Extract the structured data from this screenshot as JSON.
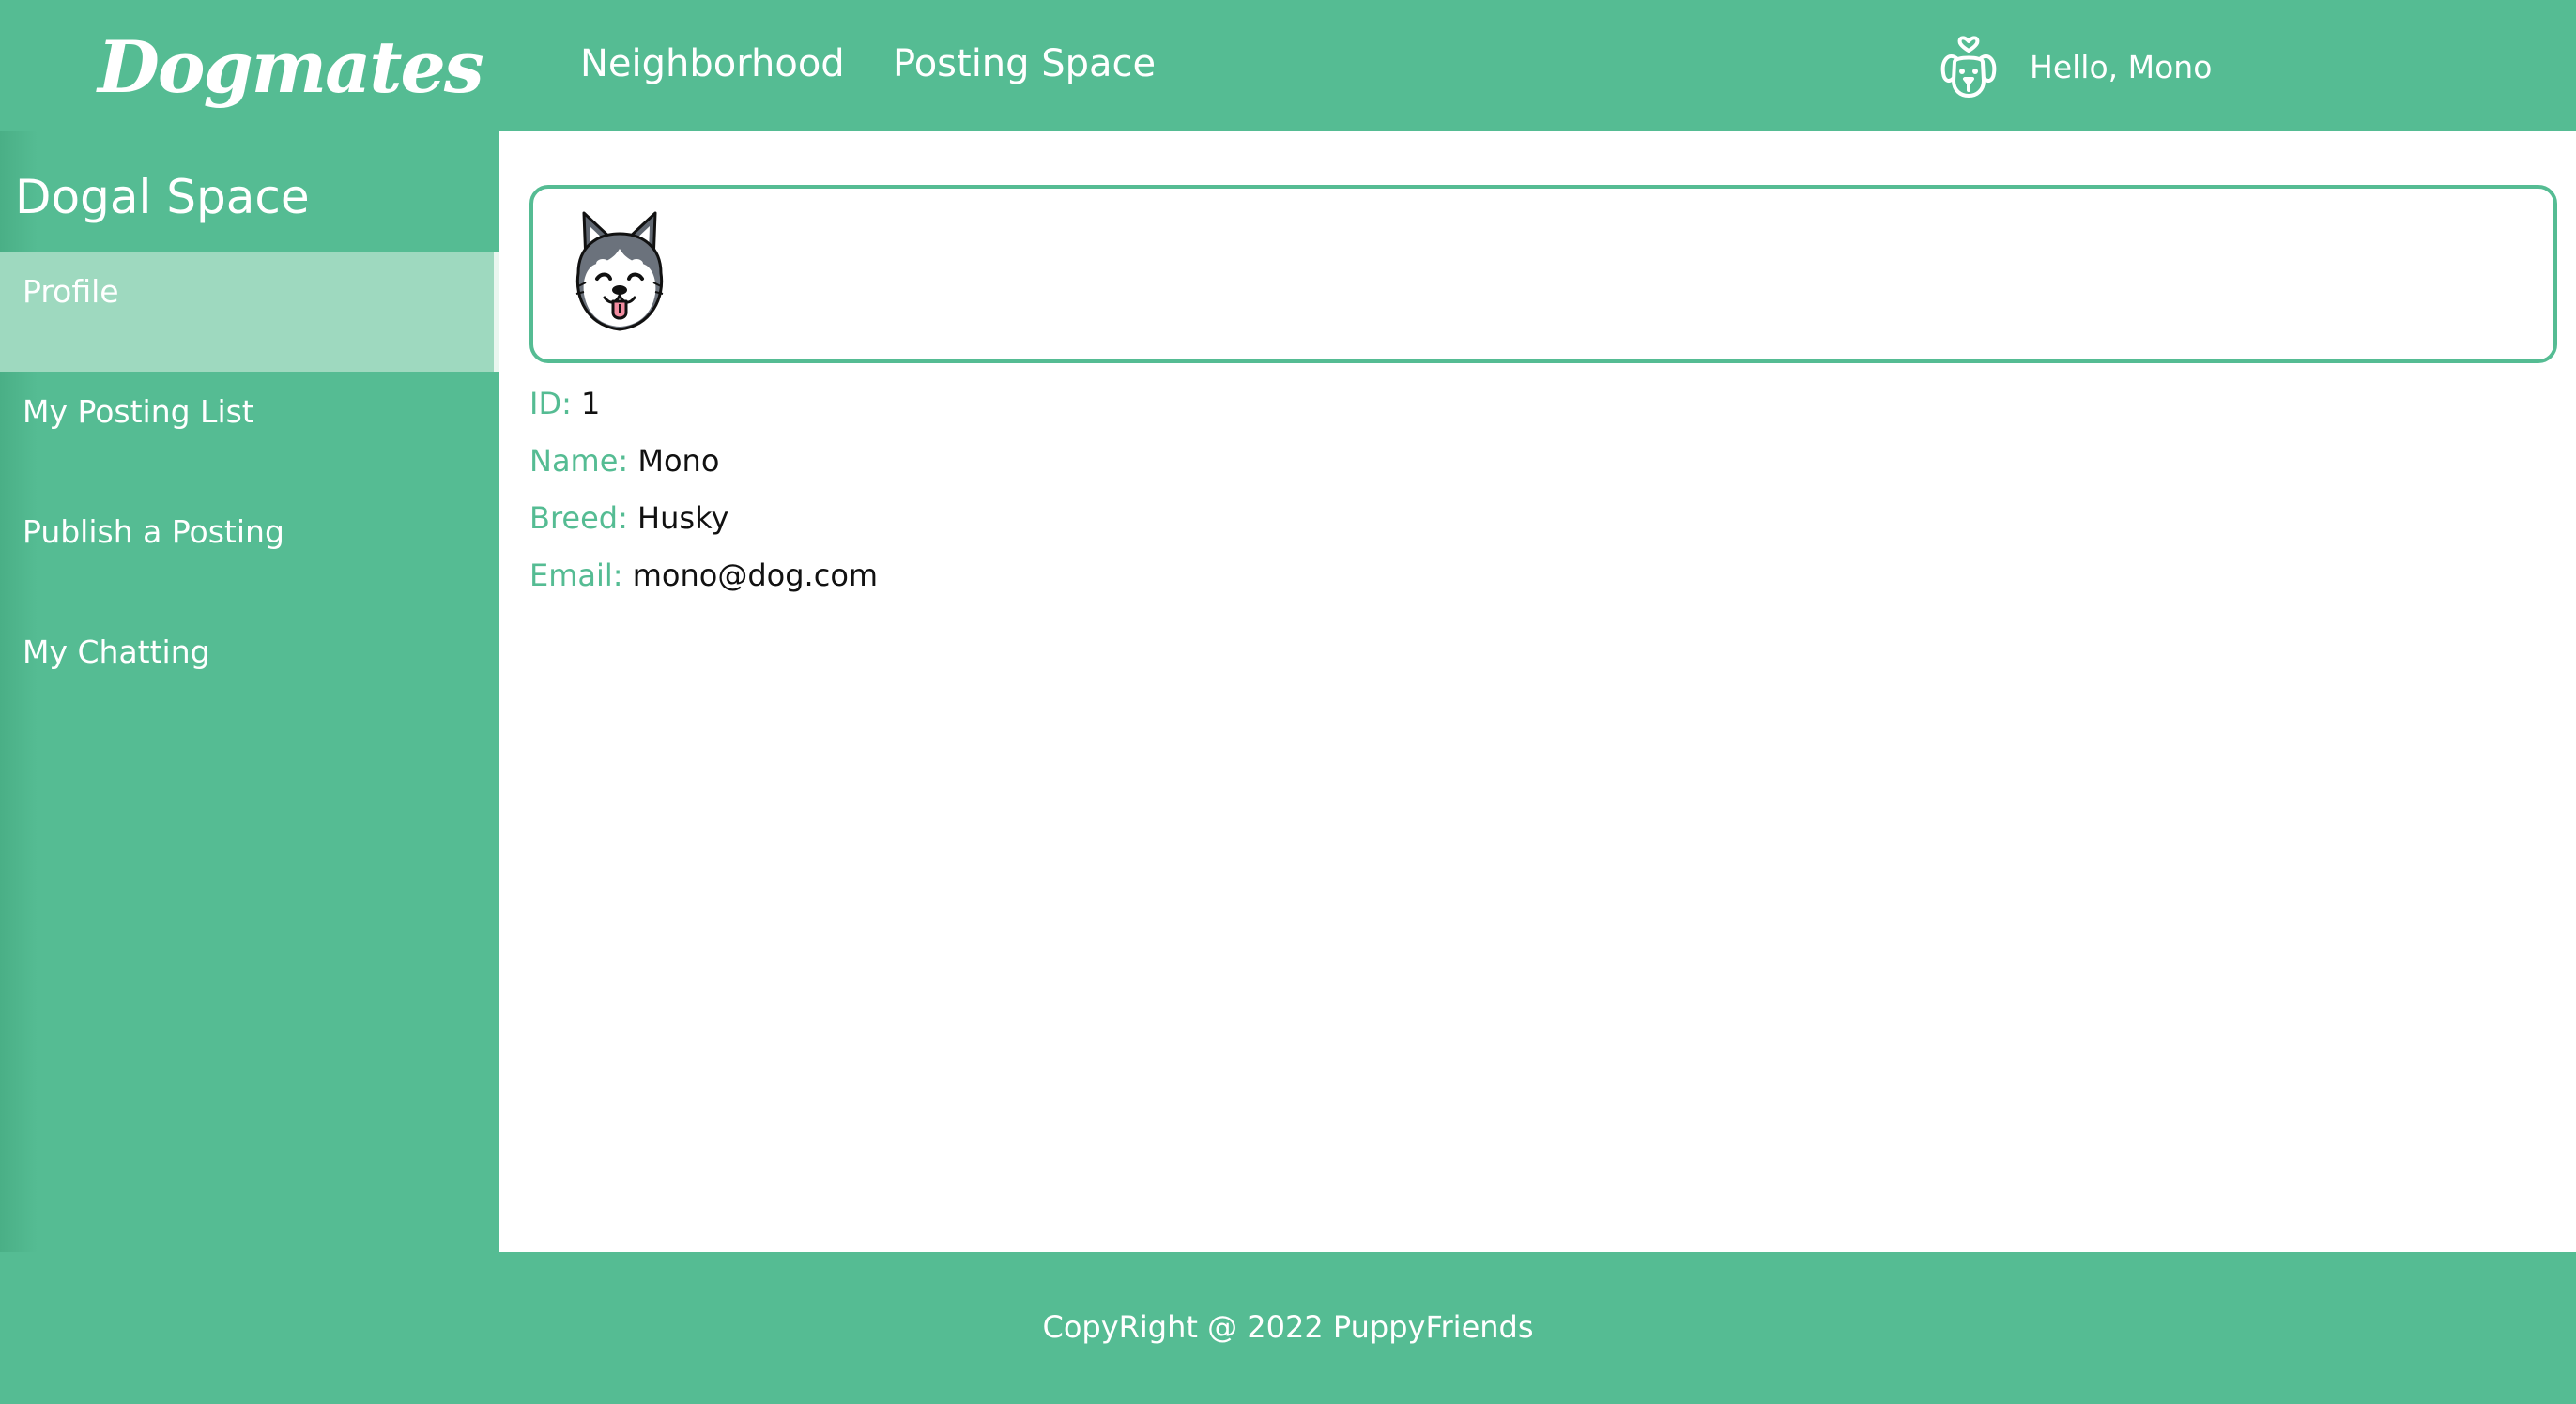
{
  "header": {
    "logo": "Dogmates",
    "nav": [
      {
        "label": "Neighborhood"
      },
      {
        "label": "Posting Space"
      }
    ],
    "user": {
      "icon": "dog-face-icon",
      "greeting": "Hello, Mono"
    }
  },
  "sidebar": {
    "title": "Dogal Space",
    "items": [
      {
        "label": "Profile",
        "active": true
      },
      {
        "label": "My Posting List"
      },
      {
        "label": "Publish a Posting"
      },
      {
        "label": "My Chatting"
      }
    ]
  },
  "profile": {
    "avatar": "husky-avatar",
    "fields": [
      {
        "label": "ID:",
        "value": "1"
      },
      {
        "label": "Name:",
        "value": "Mono"
      },
      {
        "label": "Breed:",
        "value": "Husky"
      },
      {
        "label": "Email:",
        "value": "mono@dog.com"
      }
    ]
  },
  "footer": {
    "text": "CopyRight @ 2022 PuppyFriends"
  },
  "colors": {
    "primary": "#55bc93",
    "active_item": "#9ed9bf",
    "background": "#ffffff"
  }
}
